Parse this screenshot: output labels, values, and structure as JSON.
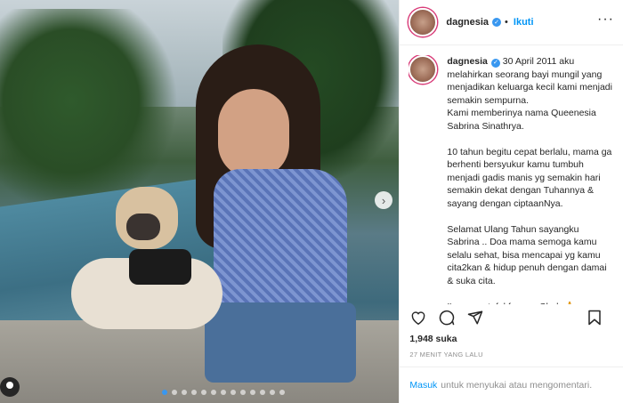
{
  "post": {
    "username": "dagnesia",
    "follow_label": "Ikuti",
    "separator": "•",
    "caption_username": "dagnesia",
    "caption_text": " 30 April 2011 aku melahirkan seorang bayi mungil yang menjadikan keluarga kecil kami menjadi semakin sempurna.\nKami memberinya nama Queenesia Sabrina Sinathrya.\n\n10 tahun begitu cepat berlalu, mama ga berhenti bersyukur kamu tumbuh menjadi gadis manis yg semakin hari semakin dekat dengan Tuhannya & sayang dengan ciptaanNya.\n\nSelamat Ulang Tahun sayangku Sabrina .. Doa mama semoga kamu selalu sehat, bisa mencapai yg kamu cita2kan & hidup penuh dengan damai & suka cita.\n\nI'm so grateful for you Chub 🙏\n& I love you so much … forever & ever 💕",
    "likes": "1,948 suka",
    "timestamp": "27 MENIT YANG LALU",
    "login_link": "Masuk",
    "login_rest": "untuk menyukai atau mengomentari."
  },
  "icons": {
    "more": "more-options-icon",
    "like": "heart-icon",
    "comment": "comment-icon",
    "share": "share-icon",
    "save": "bookmark-icon",
    "next": "chevron-right-icon",
    "user": "user-tag-icon"
  },
  "carousel": {
    "slides": 13,
    "active_index": 0
  },
  "colors": {
    "accent": "#0095f6",
    "verified": "#3897f0",
    "text": "#262626",
    "muted": "#8e8e8e"
  }
}
